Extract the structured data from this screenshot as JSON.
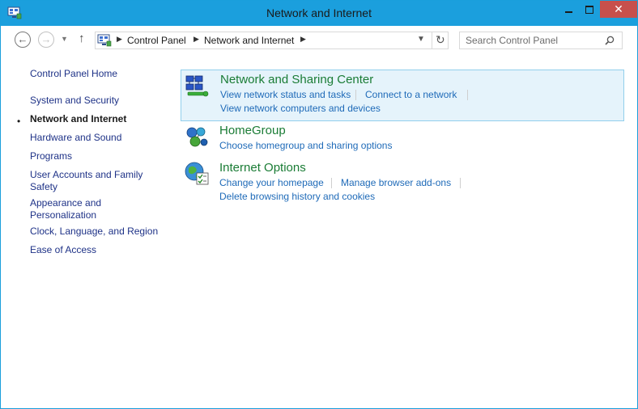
{
  "window": {
    "title": "Network and Internet",
    "close_label": "✕"
  },
  "navigation": {
    "breadcrumbs": [
      "Control Panel",
      "Network and Internet"
    ],
    "search_placeholder": "Search Control Panel"
  },
  "sidebar": {
    "home": "Control Panel Home",
    "items": [
      {
        "label": "System and Security"
      },
      {
        "label": "Network and Internet",
        "active": true
      },
      {
        "label": "Hardware and Sound"
      },
      {
        "label": "Programs"
      },
      {
        "label": "User Accounts and Family Safety"
      },
      {
        "label": "Appearance and Personalization"
      },
      {
        "label": "Clock, Language, and Region"
      },
      {
        "label": "Ease of Access"
      }
    ]
  },
  "categories": [
    {
      "title": "Network and Sharing Center",
      "icon": "network-sharing-center-icon",
      "tasks": [
        "View network status and tasks",
        "Connect to a network",
        "View network computers and devices"
      ]
    },
    {
      "title": "HomeGroup",
      "icon": "homegroup-icon",
      "tasks": [
        "Choose homegroup and sharing options"
      ]
    },
    {
      "title": "Internet Options",
      "icon": "internet-options-icon",
      "tasks": [
        "Change your homepage",
        "Manage browser add-ons",
        "Delete browsing history and cookies"
      ]
    }
  ],
  "colors": {
    "titlebar": "#1b9fdd",
    "close_button": "#c7504c",
    "category_title": "#1a7c35",
    "task_link": "#1e6ab8",
    "sidebar_link": "#1e3287",
    "highlight_bg": "#e5f3fb",
    "highlight_border": "#92cfec"
  }
}
